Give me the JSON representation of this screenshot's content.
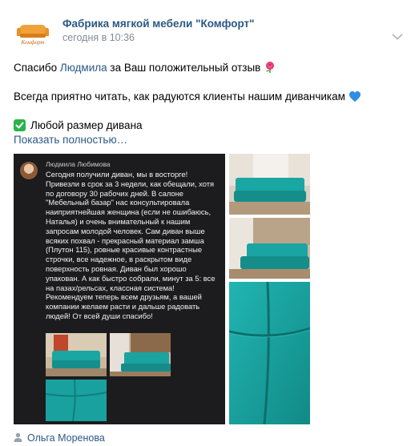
{
  "post": {
    "author": "Фабрика мягкой мебели \"Комфорт\"",
    "time": "сегодня в 10:36",
    "logo_text": "Комфорт",
    "text": {
      "line1_before": "Спасибо ",
      "line1_link": "Людмила",
      "line1_after": " за Ваш положительный отзыв",
      "line2": "Всегда приятно читать, как радуются клиенты нашим диванчикам",
      "line3": "Любой размер дивана",
      "show_more": "Показать полностью…"
    },
    "review": {
      "name": "Людмила Любимова",
      "text": "Сегодня получили диван, мы в восторге! Привезли в срок за 3 недели, как обещали, хотя по договору 30 рабочих дней. В салоне \"Мебельный базар\" нас консультировала наиприятнейшая женщина (если не ошибаюсь, Наталья) и очень внимательный к нашим запросам молодой человек. Сам диван выше всяких похвал - прекрасный материал замша (Плутон 115), ровные красивые контрастные строчки, все надежное, в раскрытом виде поверхность ровная. Диван был хорошо упакован. А как быстро собрали, минут за 5: все на пазах/рельсах, классная система! Рекомендуем теперь всем друзьям, а вашей компании желаем расти и дальше радовать людей! От всей души спасибо!"
    },
    "source": "Ольга Моренова"
  },
  "icons": {
    "rose": "rose-icon",
    "heart": "blue-heart-icon",
    "check": "check-mark-icon",
    "chevron": "chevron-down-icon",
    "person": "person-icon"
  },
  "colors": {
    "link": "#2a5885",
    "muted": "#818c99",
    "check": "#29b34a",
    "sofa": "#1aa6a3"
  }
}
